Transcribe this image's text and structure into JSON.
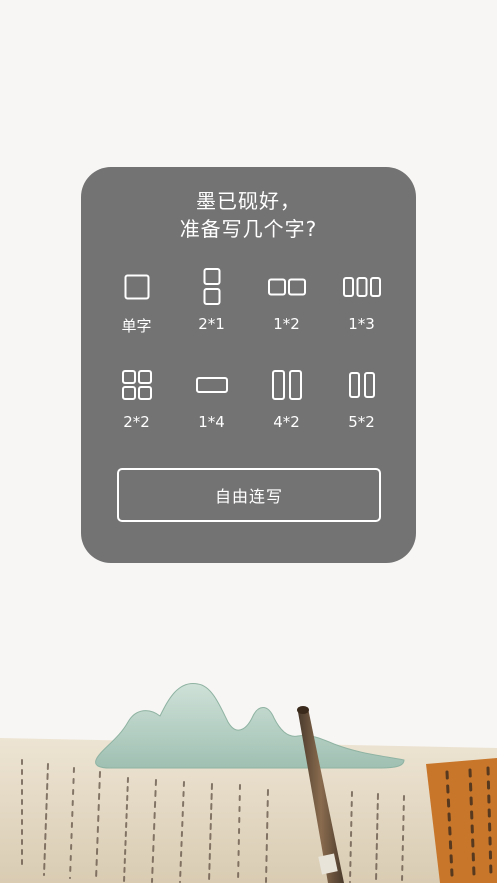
{
  "dialog": {
    "title_line1": "墨已砚好，",
    "title_line2": "准备写几个字?",
    "options": [
      {
        "label": "单字",
        "icon": "single-square-icon"
      },
      {
        "label": "2*1",
        "icon": "two-stacked-squares-icon"
      },
      {
        "label": "1*2",
        "icon": "two-side-by-side-squares-icon"
      },
      {
        "label": "1*3",
        "icon": "three-side-by-side-icon"
      },
      {
        "label": "2*2",
        "icon": "four-grid-icon"
      },
      {
        "label": "1*4",
        "icon": "wide-rectangle-icon"
      },
      {
        "label": "4*2",
        "icon": "two-tall-rectangles-icon"
      },
      {
        "label": "5*2",
        "icon": "two-narrow-rectangles-icon"
      }
    ],
    "free_write_label": "自由连写"
  },
  "colors": {
    "background": "#f7f6f4",
    "card": "#747373",
    "text": "#ffffff"
  }
}
